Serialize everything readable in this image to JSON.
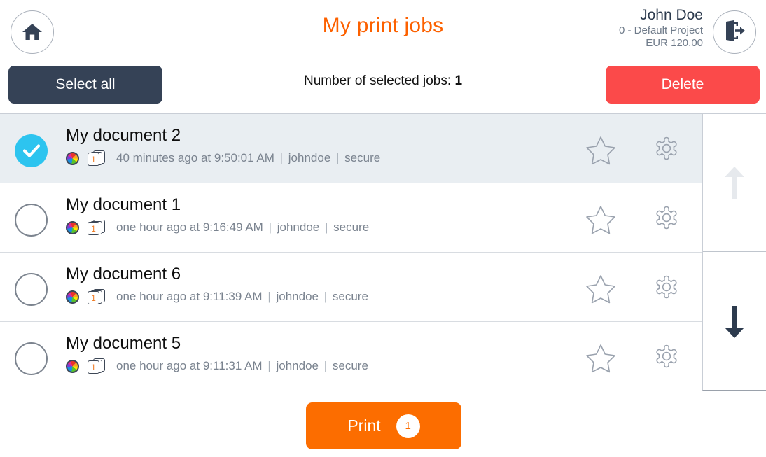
{
  "header": {
    "title": "My print jobs",
    "home_icon": "home-icon",
    "logout_icon": "logout-icon",
    "user": {
      "name": "John Doe",
      "project": "0 - Default Project",
      "balance": "EUR 120.00"
    }
  },
  "actionbar": {
    "select_all_label": "Select all",
    "selected_count_prefix": "Number of selected jobs:",
    "selected_count_value": "1",
    "delete_label": "Delete"
  },
  "colors": {
    "accent_orange": "#fc6100",
    "print_orange": "#fc6d00",
    "delete_red": "#fb4a4a",
    "dark_navy": "#354256",
    "check_cyan": "#2dc4ef",
    "selected_row_bg": "#e9eef2"
  },
  "jobs": [
    {
      "title": "My document 2",
      "selected": true,
      "pages": "1",
      "time": "40 minutes ago at 9:50:01 AM",
      "user": "johndoe",
      "mode": "secure",
      "color_icon": "color-wheel-icon",
      "pages_icon": "page-count-icon",
      "star_icon": "star-icon",
      "gear_icon": "gear-icon"
    },
    {
      "title": "My document 1",
      "selected": false,
      "pages": "1",
      "time": "one hour ago at 9:16:49 AM",
      "user": "johndoe",
      "mode": "secure",
      "color_icon": "color-wheel-icon",
      "pages_icon": "page-count-icon",
      "star_icon": "star-icon",
      "gear_icon": "gear-icon"
    },
    {
      "title": "My document 6",
      "selected": false,
      "pages": "1",
      "time": "one hour ago at 9:11:39 AM",
      "user": "johndoe",
      "mode": "secure",
      "color_icon": "color-wheel-icon",
      "pages_icon": "page-count-icon",
      "star_icon": "star-icon",
      "gear_icon": "gear-icon"
    },
    {
      "title": "My document 5",
      "selected": false,
      "pages": "1",
      "time": "one hour ago at 9:11:31 AM",
      "user": "johndoe",
      "mode": "secure",
      "color_icon": "color-wheel-icon",
      "pages_icon": "page-count-icon",
      "star_icon": "star-icon",
      "gear_icon": "gear-icon"
    }
  ],
  "scroll": {
    "up_icon": "arrow-up-icon",
    "up_enabled": false,
    "down_icon": "arrow-down-icon",
    "down_enabled": true
  },
  "footer": {
    "print_label": "Print",
    "print_badge": "1"
  },
  "separator": "|"
}
